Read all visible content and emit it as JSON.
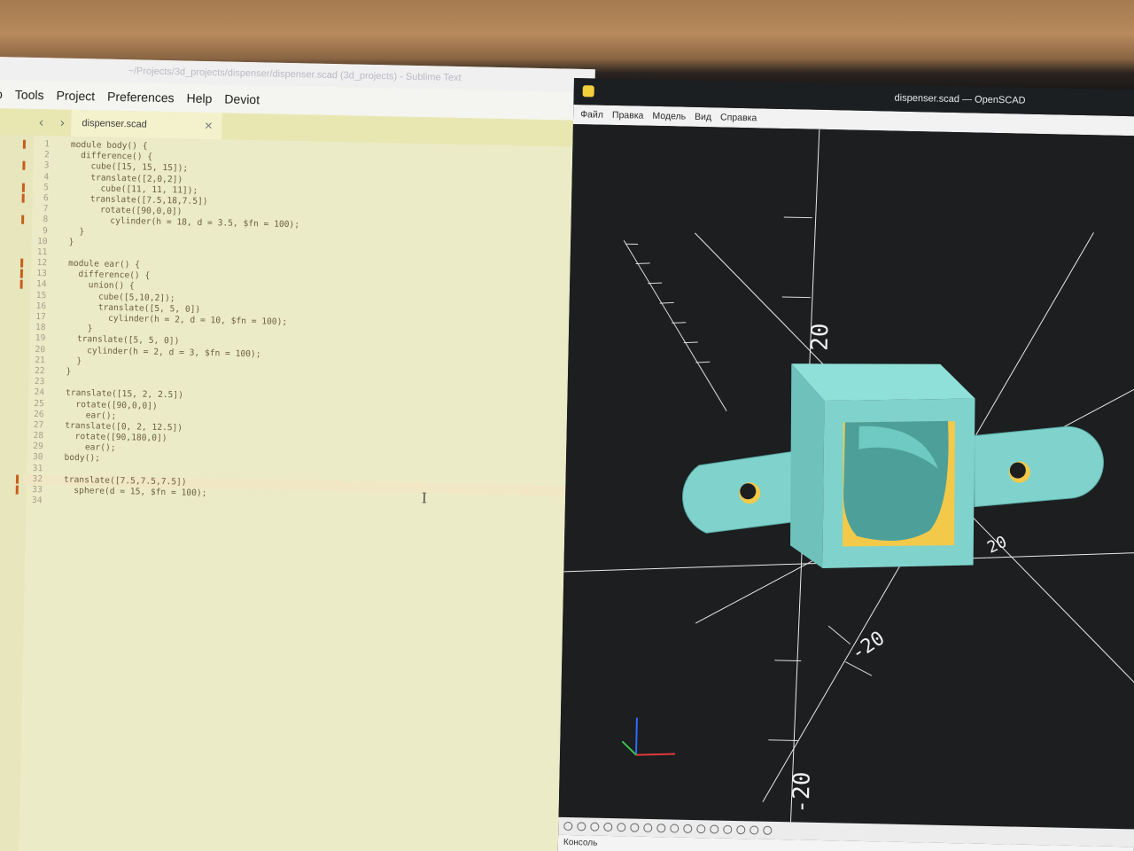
{
  "sublime": {
    "title": "~/Projects/3d_projects/dispenser/dispenser.scad (3d_projects) - Sublime Text",
    "menu": [
      "o",
      "Tools",
      "Project",
      "Preferences",
      "Help",
      "Deviot"
    ],
    "tab": "dispenser.scad",
    "code": [
      {
        "n": "1",
        "t": "module body() {"
      },
      {
        "n": "2",
        "t": "  difference() {"
      },
      {
        "n": "3",
        "t": "    cube([15, 15, 15]);"
      },
      {
        "n": "4",
        "t": "    translate([2,0,2])"
      },
      {
        "n": "5",
        "t": "      cube([11, 11, 11]);"
      },
      {
        "n": "6",
        "t": "    translate([7.5,18,7.5])"
      },
      {
        "n": "7",
        "t": "      rotate([90,0,0])"
      },
      {
        "n": "8",
        "t": "        cylinder(h = 18, d = 3.5, $fn = 100);"
      },
      {
        "n": "9",
        "t": "  }"
      },
      {
        "n": "10",
        "t": "}"
      },
      {
        "n": "11",
        "t": ""
      },
      {
        "n": "12",
        "t": "module ear() {"
      },
      {
        "n": "13",
        "t": "  difference() {"
      },
      {
        "n": "14",
        "t": "    union() {"
      },
      {
        "n": "15",
        "t": "      cube([5,10,2]);"
      },
      {
        "n": "16",
        "t": "      translate([5, 5, 0])"
      },
      {
        "n": "17",
        "t": "        cylinder(h = 2, d = 10, $fn = 100);"
      },
      {
        "n": "18",
        "t": "    }"
      },
      {
        "n": "19",
        "t": "  translate([5, 5, 0])"
      },
      {
        "n": "20",
        "t": "    cylinder(h = 2, d = 3, $fn = 100);"
      },
      {
        "n": "21",
        "t": "  }"
      },
      {
        "n": "22",
        "t": "}"
      },
      {
        "n": "23",
        "t": ""
      },
      {
        "n": "24",
        "t": "translate([15, 2, 2.5])"
      },
      {
        "n": "25",
        "t": "  rotate([90,0,0])"
      },
      {
        "n": "26",
        "t": "    ear();"
      },
      {
        "n": "27",
        "t": "translate([0, 2, 12.5])"
      },
      {
        "n": "28",
        "t": "  rotate([90,180,0])"
      },
      {
        "n": "29",
        "t": "    ear();"
      },
      {
        "n": "30",
        "t": "body();"
      },
      {
        "n": "31",
        "t": ""
      },
      {
        "n": "32",
        "t": "translate([7.5,7.5,7.5])"
      },
      {
        "n": "33",
        "t": "  sphere(d = 15, $fn = 100);"
      },
      {
        "n": "34",
        "t": ""
      }
    ]
  },
  "openscad": {
    "title": "dispenser.scad — OpenSCAD",
    "menu": [
      "Файл",
      "Правка",
      "Модель",
      "Вид",
      "Справка"
    ],
    "axis_labels": [
      "20",
      "-20",
      "-20",
      "20"
    ],
    "console_label": "Консоль"
  },
  "colors": {
    "model_face": "#7fd3cc",
    "model_cut": "#f3c94a",
    "editor_bg": "#ecebc7",
    "viewport_bg": "#1c1e20"
  }
}
